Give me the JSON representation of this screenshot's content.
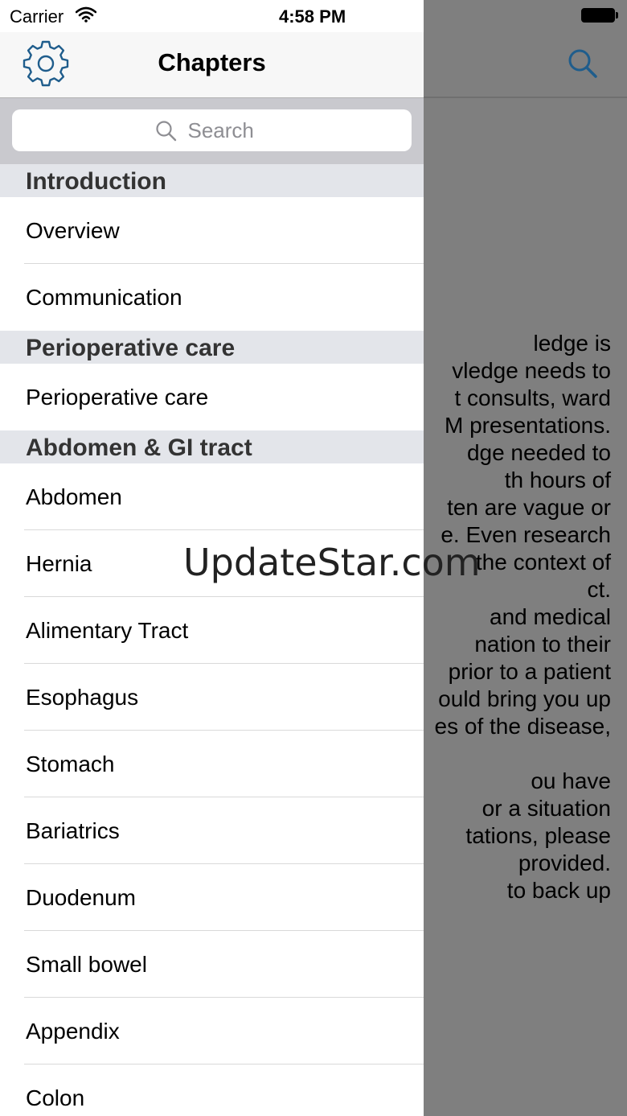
{
  "status_bar": {
    "carrier": "Carrier",
    "time": "4:58 PM"
  },
  "nav": {
    "title": "Chapters"
  },
  "search": {
    "placeholder": "Search"
  },
  "sections": [
    {
      "title": "Introduction",
      "items": [
        "Overview",
        "Communication"
      ]
    },
    {
      "title": "Perioperative care",
      "items": [
        "Perioperative care"
      ]
    },
    {
      "title": "Abdomen & GI tract",
      "items": [
        "Abdomen",
        "Hernia",
        "Alimentary Tract",
        "Esophagus",
        "Stomach",
        "Bariatrics",
        "Duodenum",
        "Small bowel",
        "Appendix",
        "Colon"
      ]
    }
  ],
  "background_text_lines": [
    "ledge is",
    "vledge needs to",
    "t consults, ward",
    "M presentations.",
    "dge needed to",
    "th hours of",
    "ten are vague or",
    "e.  Even research",
    "the context of",
    "ct.",
    "and medical",
    "nation to their",
    "prior to a patient",
    "ould bring you up",
    "es of the disease,",
    "",
    "ou have",
    "or a situation",
    "tations, please",
    "provided.",
    "to back up"
  ],
  "watermark": "UpdateStar.com",
  "icons": {
    "settings": "gear-icon",
    "search": "search-icon",
    "wifi": "wifi-icon",
    "battery": "battery-icon"
  },
  "colors": {
    "accent": "#1f5d8c",
    "section_bg": "#e3e5ea",
    "dim_overlay": "#7f7f7f"
  }
}
